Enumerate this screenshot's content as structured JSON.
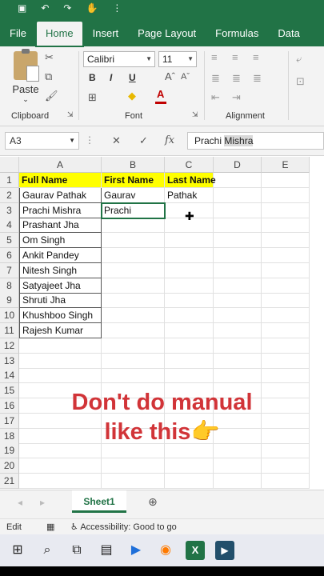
{
  "ribbon_tabs": [
    "File",
    "Home",
    "Insert",
    "Page Layout",
    "Formulas",
    "Data"
  ],
  "active_tab": "Home",
  "ribbon": {
    "paste_label": "Paste",
    "clipboard_label": "Clipboard",
    "font_name": "Calibri",
    "font_size": "11",
    "bold": "B",
    "italic": "I",
    "underline": "U",
    "font_label": "Font",
    "alignment_label": "Alignment"
  },
  "formula_bar": {
    "name_box": "A3",
    "fx": "fx",
    "content_plain": "Prachi ",
    "content_highlight": "Mishra"
  },
  "columns": [
    "A",
    "B",
    "C",
    "D",
    "E"
  ],
  "rows": [
    [
      "Full Name",
      "First Name",
      "Last Name"
    ],
    [
      "Gaurav Pathak",
      "Gaurav",
      "Pathak"
    ],
    [
      "Prachi Mishra",
      "Prachi",
      ""
    ],
    [
      "Prashant Jha",
      "",
      ""
    ],
    [
      "Om Singh",
      "",
      ""
    ],
    [
      "Ankit Pandey",
      "",
      ""
    ],
    [
      "Nitesh Singh",
      "",
      ""
    ],
    [
      "Satyajeet Jha",
      "",
      ""
    ],
    [
      "Shruti Jha",
      "",
      ""
    ],
    [
      "Khushboo Singh",
      "",
      ""
    ],
    [
      "Rajesh Kumar",
      "",
      ""
    ],
    [
      "",
      "",
      ""
    ],
    [
      "",
      "",
      ""
    ],
    [
      "",
      "",
      ""
    ],
    [
      "",
      "",
      ""
    ],
    [
      "",
      "",
      ""
    ],
    [
      "",
      "",
      ""
    ],
    [
      "",
      "",
      ""
    ],
    [
      "",
      "",
      ""
    ],
    [
      "",
      "",
      ""
    ],
    [
      "",
      "",
      ""
    ]
  ],
  "row_numbers": [
    "1",
    "2",
    "3",
    "4",
    "5",
    "6",
    "7",
    "8",
    "9",
    "10",
    "11",
    "12",
    "13",
    "14",
    "15",
    "16",
    "17",
    "18",
    "19",
    "20",
    "21"
  ],
  "overlay": {
    "line1": "Don't do manual",
    "line2": "like this"
  },
  "sheet_tab": "Sheet1",
  "status": {
    "mode": "Edit",
    "accessibility": "Accessibility: Good to go"
  },
  "accent": "#217346"
}
